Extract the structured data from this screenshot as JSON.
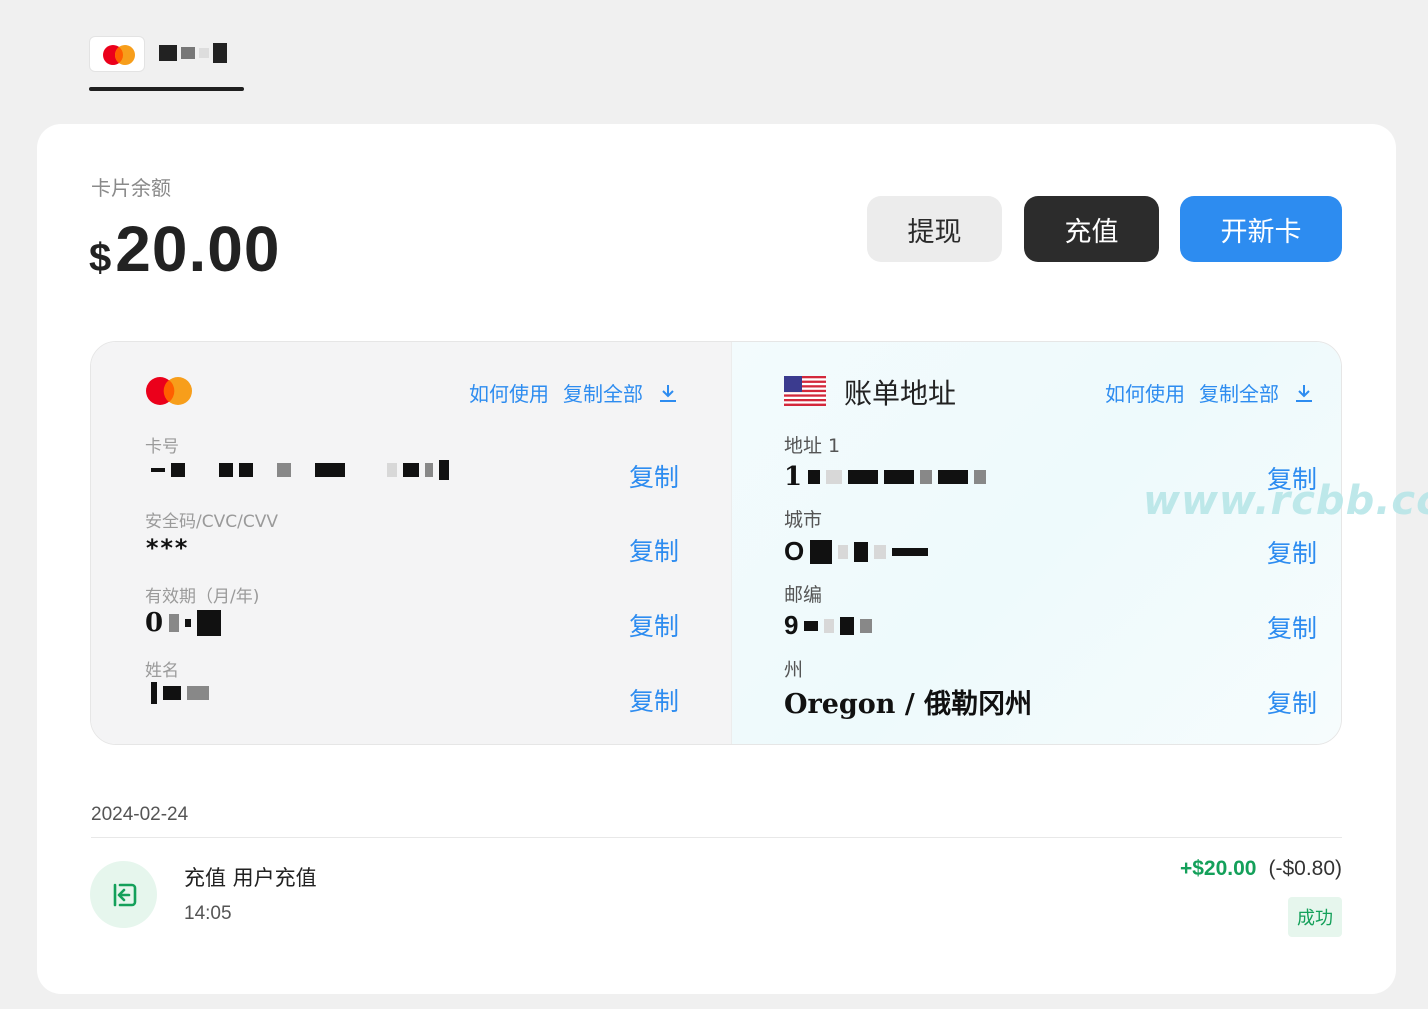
{
  "tab": {
    "logo": "mastercard-logo"
  },
  "balance": {
    "label": "卡片余额",
    "currency": "$",
    "amount": "20.00"
  },
  "actions": {
    "withdraw": "提现",
    "topup": "充值",
    "new_card": "开新卡"
  },
  "card_pane": {
    "how_to_use": "如何使用",
    "copy_all": "复制全部",
    "fields": [
      {
        "label": "卡号",
        "value": "",
        "copy": "复制"
      },
      {
        "label": "安全码/CVC/CVV",
        "value": "***",
        "copy": "复制"
      },
      {
        "label": "有效期（月/年)",
        "value": "0",
        "copy": "复制"
      },
      {
        "label": "姓名",
        "value": "",
        "copy": "复制"
      }
    ]
  },
  "addr_pane": {
    "title": "账单地址",
    "how_to_use": "如何使用",
    "copy_all": "复制全部",
    "fields": [
      {
        "label": "地址 1",
        "value": "1",
        "copy": "复制"
      },
      {
        "label": "城市",
        "value": "O",
        "copy": "复制"
      },
      {
        "label": "邮编",
        "value": "9",
        "copy": "复制"
      },
      {
        "label": "州",
        "value": "Oregon / 俄勒冈州",
        "copy": "复制"
      }
    ]
  },
  "transactions": {
    "date": "2024-02-24",
    "items": [
      {
        "title": "充值 用户充值",
        "time": "14:05",
        "amount": "+$20.00",
        "fee": "(-$0.80)",
        "status": "成功"
      }
    ]
  },
  "watermark": "www.rcbb.cc",
  "colors": {
    "accent": "#2d8cf0",
    "dark_button": "#2c2c2c",
    "success": "#14a05a"
  }
}
